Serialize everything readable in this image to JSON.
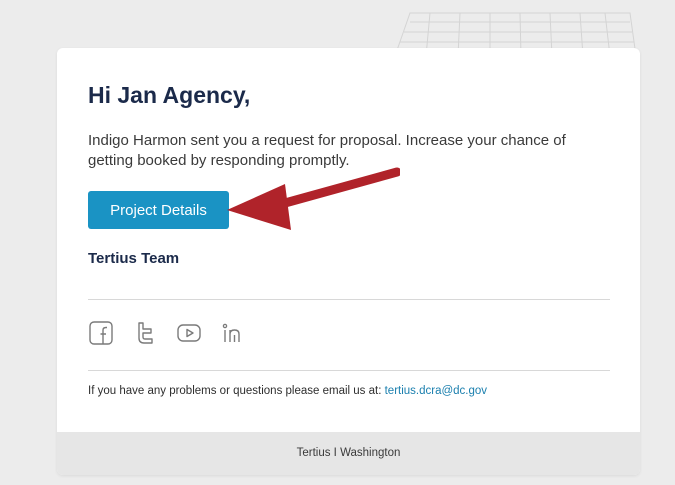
{
  "email": {
    "greeting": "Hi Jan Agency,",
    "message": "Indigo Harmon sent you a request for proposal. Increase your chance of getting booked by responding promptly.",
    "cta_label": "Project Details",
    "signature": "Tertius Team",
    "social_icons": [
      "facebook-icon",
      "twitter-icon",
      "youtube-icon",
      "linkedin-icon"
    ],
    "contact_text": "If you have any problems or questions please email us at: ",
    "contact_email": "tertius.dcra@dc.gov",
    "footer": "Tertius I Washington"
  },
  "colors": {
    "button": "#1a93c4",
    "heading": "#1b2a4a",
    "link": "#1a7fae",
    "arrow": "#b0232a",
    "footer_bg": "#e6e6e6"
  }
}
